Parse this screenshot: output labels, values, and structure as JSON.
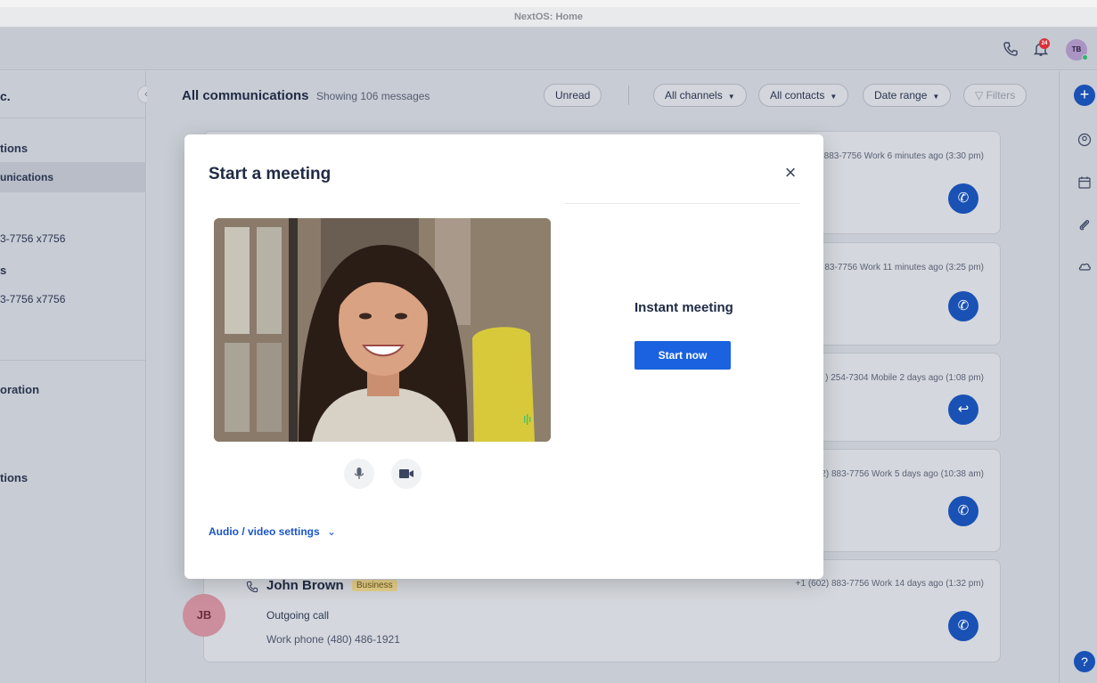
{
  "window": {
    "title": "NextOS: Home"
  },
  "header": {
    "notification_count": "24",
    "user_initials": "TB"
  },
  "sidebar": {
    "header_text": "c.",
    "items": [
      {
        "label": "tions"
      },
      {
        "label": "unications"
      },
      {
        "label": "3-7756 x7756"
      },
      {
        "label": "s"
      },
      {
        "label": "3-7756 x7756"
      },
      {
        "label": "oration"
      },
      {
        "label": "tions"
      }
    ]
  },
  "main": {
    "title": "All communications",
    "count_text": "Showing 106 messages",
    "filters": {
      "unread": "Unread",
      "channels": "All channels",
      "contacts": "All contacts",
      "date_range": "Date range",
      "filters": "Filters"
    },
    "cards": [
      {
        "meta": "883-7756 Work   6 minutes ago (3:30 pm)"
      },
      {
        "meta": "83-7756 Work   11 minutes ago (3:25 pm)"
      },
      {
        "meta": ") 254-7304 Mobile   2 days ago (1:08 pm)"
      },
      {
        "meta": "2) 883-7756 Work   5 days ago (10:38 am)"
      },
      {
        "initials": "JB",
        "name": "John Brown",
        "badge": "Business",
        "meta": "+1 (602) 883-7756 Work   14 days ago (1:32 pm)",
        "line1": "Outgoing call",
        "line2": "Work phone (480) 486-1921"
      }
    ]
  },
  "modal": {
    "title": "Start a meeting",
    "instant_label": "Instant meeting",
    "start_button": "Start now",
    "settings_link": "Audio / video settings"
  },
  "colors": {
    "accent": "#1a62e0",
    "accent_dark": "#1a51b4",
    "avatar_pink": "#cc8e9c",
    "badge_yellow": "#e5cf8a"
  }
}
